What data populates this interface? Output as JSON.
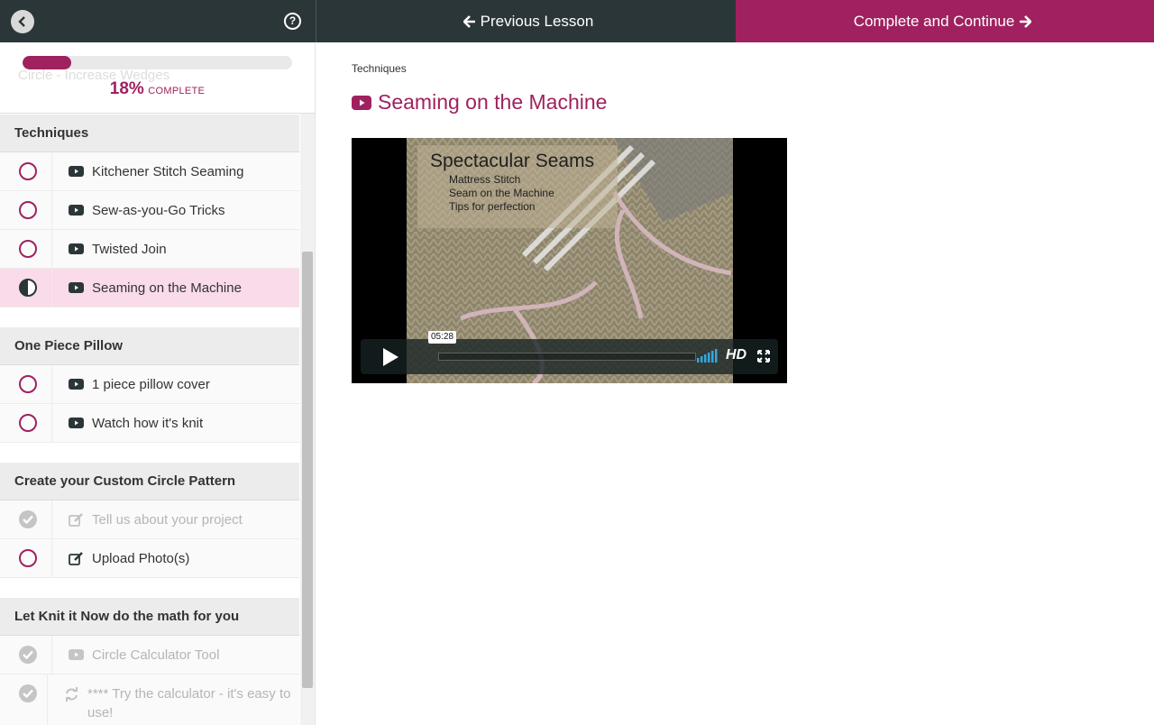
{
  "topbar": {
    "prev_label": "Previous Lesson",
    "next_label": "Complete and Continue"
  },
  "progress": {
    "percent": 18,
    "percent_text": "18%",
    "label": "COMPLETE",
    "ghost_text": "Circle - Increase Wedges"
  },
  "sections": [
    {
      "title": "Techniques",
      "lessons": [
        {
          "title": "Kitchener Stitch Seaming",
          "status": "incomplete",
          "type": "video"
        },
        {
          "title": "Sew-as-you-Go Tricks",
          "status": "incomplete",
          "type": "video"
        },
        {
          "title": "Twisted Join",
          "status": "incomplete",
          "type": "video"
        },
        {
          "title": "Seaming on the Machine",
          "status": "in-progress",
          "type": "video"
        }
      ]
    },
    {
      "title": "One Piece Pillow",
      "lessons": [
        {
          "title": "1 piece pillow cover",
          "status": "incomplete",
          "type": "video"
        },
        {
          "title": "Watch how it's knit",
          "status": "incomplete",
          "type": "video"
        }
      ]
    },
    {
      "title": "Create your Custom Circle Pattern",
      "lessons": [
        {
          "title": "Tell us about your project",
          "status": "complete",
          "type": "edit"
        },
        {
          "title": "Upload Photo(s)",
          "status": "incomplete",
          "type": "edit"
        }
      ]
    },
    {
      "title": "Let Knit it Now do the math for you",
      "lessons": [
        {
          "title": "Circle Calculator Tool",
          "status": "complete",
          "type": "video"
        },
        {
          "title": "**** Try the calculator - it's easy to use!",
          "status": "complete",
          "type": "refresh"
        }
      ]
    }
  ],
  "main": {
    "breadcrumb": "Techniques",
    "title": "Seaming on the Machine"
  },
  "video": {
    "slide_title": "Spectacular Seams",
    "slide_lines": [
      "Mattress Stitch",
      "Seam on the Machine",
      "Tips for perfection"
    ],
    "time": "05:28",
    "hd_label": "HD"
  },
  "colors": {
    "accent": "#a0215f",
    "topbar": "#2b3638",
    "active_row": "#f9dbe9"
  }
}
